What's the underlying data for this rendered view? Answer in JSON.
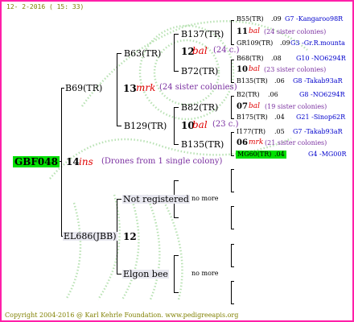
{
  "header": {
    "date": "12-  2-2016 ( 15: 33)"
  },
  "footer": {
    "copyright": "Copyright 2004-2016 @ Karl Kehrle Foundation.   www.pedigreeapis.org"
  },
  "watermark": "pedigreeapis.org",
  "colors": {
    "frame": "#ff1fa8",
    "highlight_green": "#00e000",
    "red": "#e00000",
    "purple": "#7a2fa0",
    "blue": "#0000cc",
    "footer": "#808000"
  },
  "root": {
    "id": "GBF048",
    "num": "14",
    "breeder": "ins",
    "note": "(Drones from 1 single colony)"
  },
  "father": {
    "id": "B69(TR)",
    "num": "13",
    "breeder": "mrk",
    "note": "(24 sister colonies)"
  },
  "ff": {
    "id": "B63(TR)",
    "num": "12",
    "breeder": "bal",
    "note": "(24 c.)"
  },
  "fm": {
    "id": "B129(TR)",
    "num": "10",
    "breeder": "bal",
    "note": "(23 c.)"
  },
  "fff": {
    "id": "B137(TR)"
  },
  "ffm": {
    "id": "B72(TR)"
  },
  "fmf": {
    "id": "B82(TR)"
  },
  "fmm": {
    "id": "B135(TR)"
  },
  "g4": [
    {
      "id": "B55(TR)",
      "score": ".09",
      "line": "G7 -Kangaroo98R"
    },
    {
      "num": "11",
      "breeder": "bal",
      "note": "(24 sister colonies)"
    },
    {
      "id": "GR109(TR)",
      "score": ".09",
      "line": "G3 -Gr.R.mounta"
    },
    {
      "id": "B68(TR)",
      "score": ".08",
      "line": "G10 -NO6294R"
    },
    {
      "num": "10",
      "breeder": "bal",
      "note": "(23 sister colonies)"
    },
    {
      "id": "B135(TR)",
      "score": ".06",
      "line": "G8 -Takab93aR"
    },
    {
      "id": "B2(TR)",
      "score": ".06",
      "line": "G8 -NO6294R"
    },
    {
      "num": "07",
      "breeder": "bal",
      "note": "(19 sister colonies)"
    },
    {
      "id": "B175(TR)",
      "score": ".04",
      "line": "G21 -Sinop62R"
    },
    {
      "id": "I177(TR)",
      "score": ".05",
      "line": "G7 -Takab93aR"
    },
    {
      "num": "06",
      "breeder": "mrk",
      "note": "(21 sister colonies)"
    },
    {
      "id": "MG60(TR)",
      "score": ".04",
      "line": "G4 -MG00R"
    }
  ],
  "mother": {
    "id": "EL686(JBB)",
    "num": "12"
  },
  "mf": {
    "label": "Not registered",
    "more": "no more"
  },
  "mm": {
    "label": "Elgon bee",
    "more": "no more"
  }
}
